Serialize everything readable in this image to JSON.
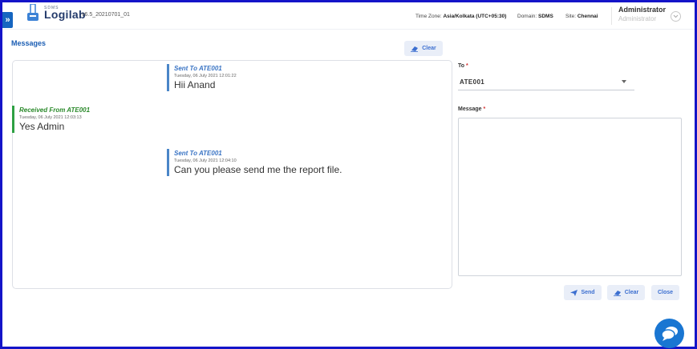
{
  "header": {
    "logo_small": "SDMS",
    "logo_text": "Logilab",
    "version": "v6.5_20210701_01",
    "timezone_label": "Time Zone:",
    "timezone_value": "Asia/Kolkata (UTC+05:30)",
    "domain_label": "Domain:",
    "domain_value": "SDMS",
    "site_label": "Site:",
    "site_value": "Chennai",
    "user_name": "Administrator",
    "user_role": "Administrator"
  },
  "page": {
    "title": "Messages",
    "clear_label": "Clear"
  },
  "messages": [
    {
      "type": "sent",
      "heading": "Sent To ATE001",
      "date": "Tuesday, 06 July 2021 12:01:22",
      "text": "Hii Anand"
    },
    {
      "type": "received",
      "heading": "Received From ATE001",
      "date": "Tuesday, 06 July 2021 12:03:13",
      "text": "Yes Admin"
    },
    {
      "type": "sent",
      "heading": "Sent To ATE001",
      "date": "Tuesday, 06 July 2021 12:04:10",
      "text": "Can you please send me the report file."
    }
  ],
  "form": {
    "to_label": "To",
    "to_value": "ATE001",
    "message_label": "Message",
    "required_mark": "*",
    "message_value": "",
    "send_label": "Send",
    "clear_label": "Clear",
    "close_label": "Close"
  },
  "colors": {
    "accent": "#1a5db3",
    "sent_border": "#4a86c8",
    "received_border": "#2ea043",
    "frame": "#1414c8",
    "fab": "#1976d2"
  },
  "icons": [
    "double-chevron-right-icon",
    "logo-icon",
    "chevron-down-icon",
    "eraser-icon",
    "send-icon",
    "chat-icon"
  ]
}
